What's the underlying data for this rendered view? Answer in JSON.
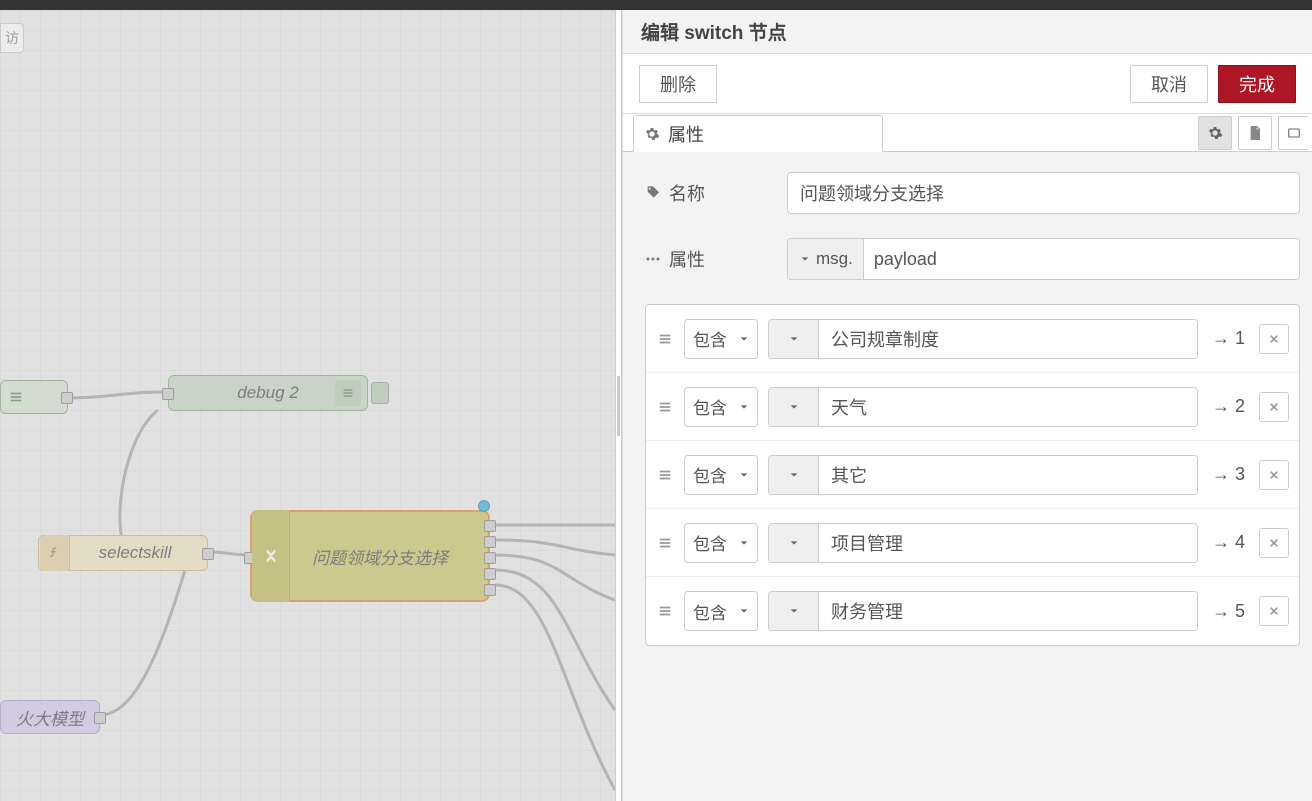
{
  "panel": {
    "title": "编辑 switch 节点",
    "delete": "删除",
    "cancel": "取消",
    "done": "完成"
  },
  "tabs": {
    "properties": "属性"
  },
  "form": {
    "name_label": "名称",
    "name_value": "问题领域分支选择",
    "prop_label": "属性",
    "prop_type": "msg.",
    "prop_value": "payload"
  },
  "rules": [
    {
      "op": "包含",
      "value": "公司规章制度",
      "output": "→ 1"
    },
    {
      "op": "包含",
      "value": "天气",
      "output": "→ 2"
    },
    {
      "op": "包含",
      "value": "其它",
      "output": "→ 3"
    },
    {
      "op": "包含",
      "value": "项目管理",
      "output": "→ 4"
    },
    {
      "op": "包含",
      "value": "财务管理",
      "output": "→ 5"
    }
  ],
  "canvas": {
    "debug_label": "debug 2",
    "selectskill_label": "selectskill",
    "switch_label": "问题领域分支选择",
    "purple_label": "火大模型",
    "half_label": "访"
  }
}
